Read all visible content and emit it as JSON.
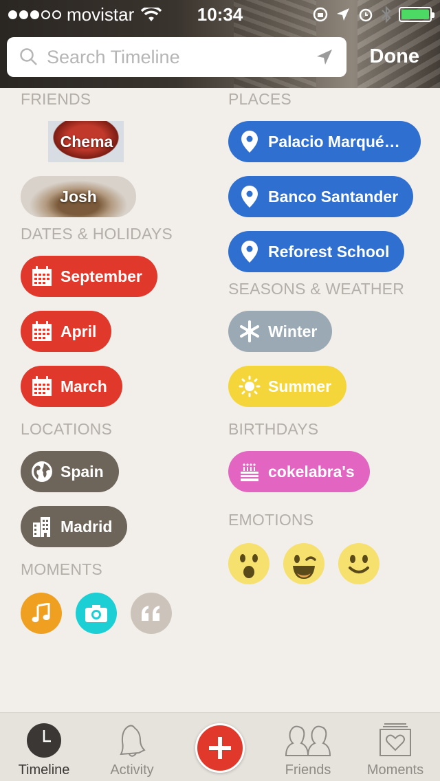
{
  "status_bar": {
    "carrier": "movistar",
    "time": "10:34",
    "signal_dots_filled": 3,
    "signal_dots_total": 5,
    "battery_percent": 100
  },
  "search": {
    "placeholder": "Search Timeline",
    "value": ""
  },
  "header": {
    "done_label": "Done"
  },
  "sections": {
    "friends": {
      "title": "FRIENDS",
      "items": [
        "Chema",
        "Josh"
      ]
    },
    "dates": {
      "title": "DATES & HOLIDAYS",
      "items": [
        "September",
        "April",
        "March"
      ]
    },
    "locations": {
      "title": "LOCATIONS",
      "items": [
        "Spain",
        "Madrid"
      ]
    },
    "moments": {
      "title": "MOMENTS",
      "icons": [
        "music-icon",
        "camera-icon",
        "quote-icon"
      ]
    },
    "places": {
      "title": "PLACES",
      "items": [
        "Palacio Marqué…",
        "Banco Santander",
        "Reforest School"
      ]
    },
    "seasons": {
      "title": "SEASONS & WEATHER",
      "items": [
        "Winter",
        "Summer"
      ]
    },
    "birthdays": {
      "title": "BIRTHDAYS",
      "items": [
        "cokelabra's"
      ]
    },
    "emotions": {
      "title": "EMOTIONS",
      "icons": [
        "surprised-face-icon",
        "winking-face-icon",
        "smiling-face-icon"
      ]
    }
  },
  "colors": {
    "date_red": "#e0382a",
    "place_blue": "#2e6fcf",
    "winter_grey": "#9aa9b4",
    "summer_yellow": "#f4d63a",
    "birthday_pink": "#e265c1",
    "location_brown": "#6d645a",
    "music_orange": "#f0a020",
    "camera_teal": "#1ccfd4",
    "quote_beige": "#ccc4ba",
    "emoji_yellow": "#f6e06e"
  },
  "tabbar": {
    "tabs": [
      "Timeline",
      "Activity",
      "Friends",
      "Moments"
    ],
    "active": "Timeline"
  }
}
